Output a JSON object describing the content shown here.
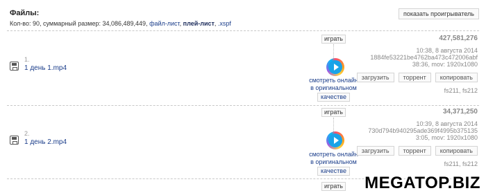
{
  "header": {
    "title": "Файлы:",
    "count_text": "Кол-во: 90, суммарный размер: 34,086,489,449,",
    "file_list_link": "файл-лист",
    "playlist_link": "плей-лист",
    "xspf_link": ".xspf",
    "show_player_label": "показать проигрыватель"
  },
  "files": [
    {
      "num": "1.",
      "name": "1 день 1.mp4",
      "play_label": "играть",
      "watch_line1": "смотреть онлайн",
      "watch_line2": "в оригинальном",
      "watch_line3": "качестве",
      "size": "427,581,276",
      "date": "10:38, 8 августа 2014",
      "hash": "1884fe53221be4762ba473c472006abf",
      "info": "38:36, mov: 1920x1080",
      "action_download": "загрузить",
      "action_torrent": "торрент",
      "action_copy": "копировать",
      "servers": "fs211, fs212"
    },
    {
      "num": "2.",
      "name": "1 день 2.mp4",
      "play_label": "играть",
      "watch_line1": "смотреть онлайн",
      "watch_line2": "в оригинальном",
      "watch_line3": "качестве",
      "size": "34,371,250",
      "date": "10:39, 8 августа 2014",
      "hash": "730d794b940295ade369f4995b375135",
      "info": "3:05, mov: 1920x1080",
      "action_download": "загрузить",
      "action_torrent": "торрент",
      "action_copy": "копировать",
      "servers": "fs211, fs212"
    }
  ],
  "next_play_label": "играть",
  "watermark": "MEGATOP.BIZ",
  "icons": {
    "save": "floppy-disk-icon",
    "play": "play-circle-icon"
  }
}
